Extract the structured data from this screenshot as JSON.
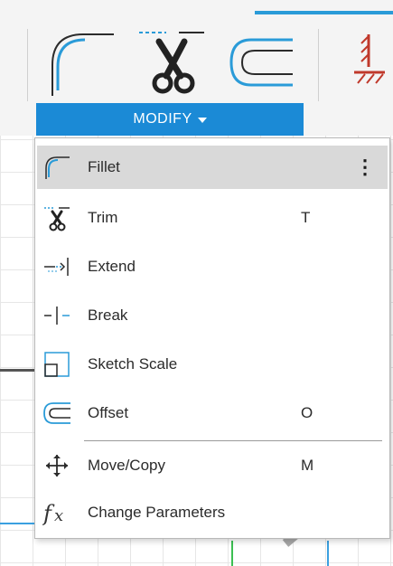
{
  "toolbar": {
    "group_label": "MODIFY",
    "tools": [
      {
        "name": "fillet",
        "icon": "fillet-icon"
      },
      {
        "name": "trim",
        "icon": "scissors-icon"
      },
      {
        "name": "offset",
        "icon": "offset-icon"
      },
      {
        "name": "constraint",
        "icon": "fix-constraint-icon"
      }
    ],
    "accent_color": "#1b8ad6"
  },
  "menu": {
    "items": [
      {
        "label": "Fillet",
        "shortcut": "",
        "icon": "fillet-icon",
        "more": "⋮",
        "highlighted": true
      },
      {
        "label": "Trim",
        "shortcut": "T",
        "icon": "scissors-icon",
        "more": "",
        "highlighted": false
      },
      {
        "label": "Extend",
        "shortcut": "",
        "icon": "extend-icon",
        "more": "",
        "highlighted": false
      },
      {
        "label": "Break",
        "shortcut": "",
        "icon": "break-icon",
        "more": "",
        "highlighted": false
      },
      {
        "label": "Sketch Scale",
        "shortcut": "",
        "icon": "sketch-scale-icon",
        "more": "",
        "highlighted": false
      },
      {
        "label": "Offset",
        "shortcut": "O",
        "icon": "offset-icon",
        "more": "",
        "highlighted": false
      },
      {
        "label": "Move/Copy",
        "shortcut": "M",
        "icon": "move-icon",
        "more": "",
        "highlighted": false
      },
      {
        "label": "Change Parameters",
        "shortcut": "",
        "icon": "fx-icon",
        "more": "",
        "highlighted": false
      }
    ]
  }
}
